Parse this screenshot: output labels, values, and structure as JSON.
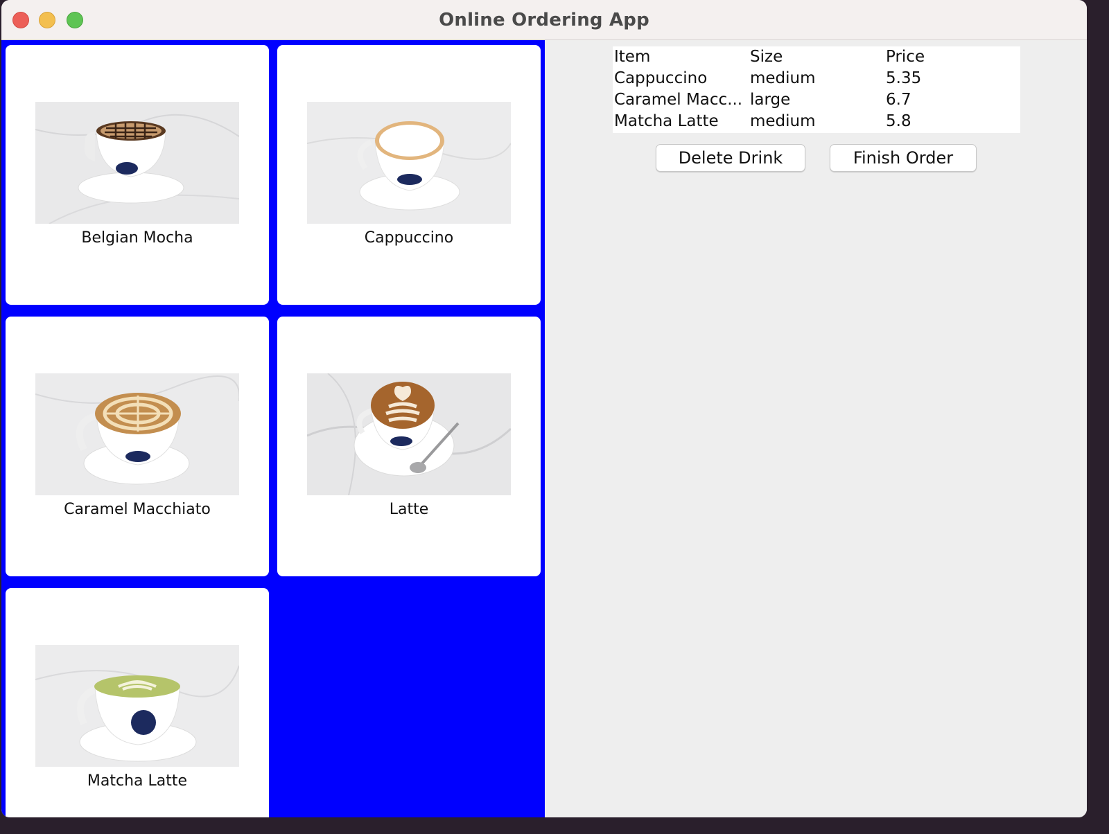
{
  "window": {
    "title": "Online Ordering App"
  },
  "menu": {
    "background": "#0000ff",
    "items": [
      {
        "label": "Belgian Mocha",
        "foam": "mocha"
      },
      {
        "label": "Cappuccino",
        "foam": "cappuccino"
      },
      {
        "label": "Caramel Macchiato",
        "foam": "caramel"
      },
      {
        "label": "Latte",
        "foam": "latte"
      },
      {
        "label": "Matcha Latte",
        "foam": "matcha"
      }
    ]
  },
  "order": {
    "headers": {
      "item": "Item",
      "size": "Size",
      "price": "Price"
    },
    "rows": [
      {
        "item": "Cappuccino",
        "size": "medium",
        "price": "5.35"
      },
      {
        "item": "Caramel Macc...",
        "size": "large",
        "price": "6.7"
      },
      {
        "item": "Matcha Latte",
        "size": "medium",
        "price": "5.8"
      }
    ],
    "delete_label": "Delete Drink",
    "finish_label": "Finish Order"
  }
}
